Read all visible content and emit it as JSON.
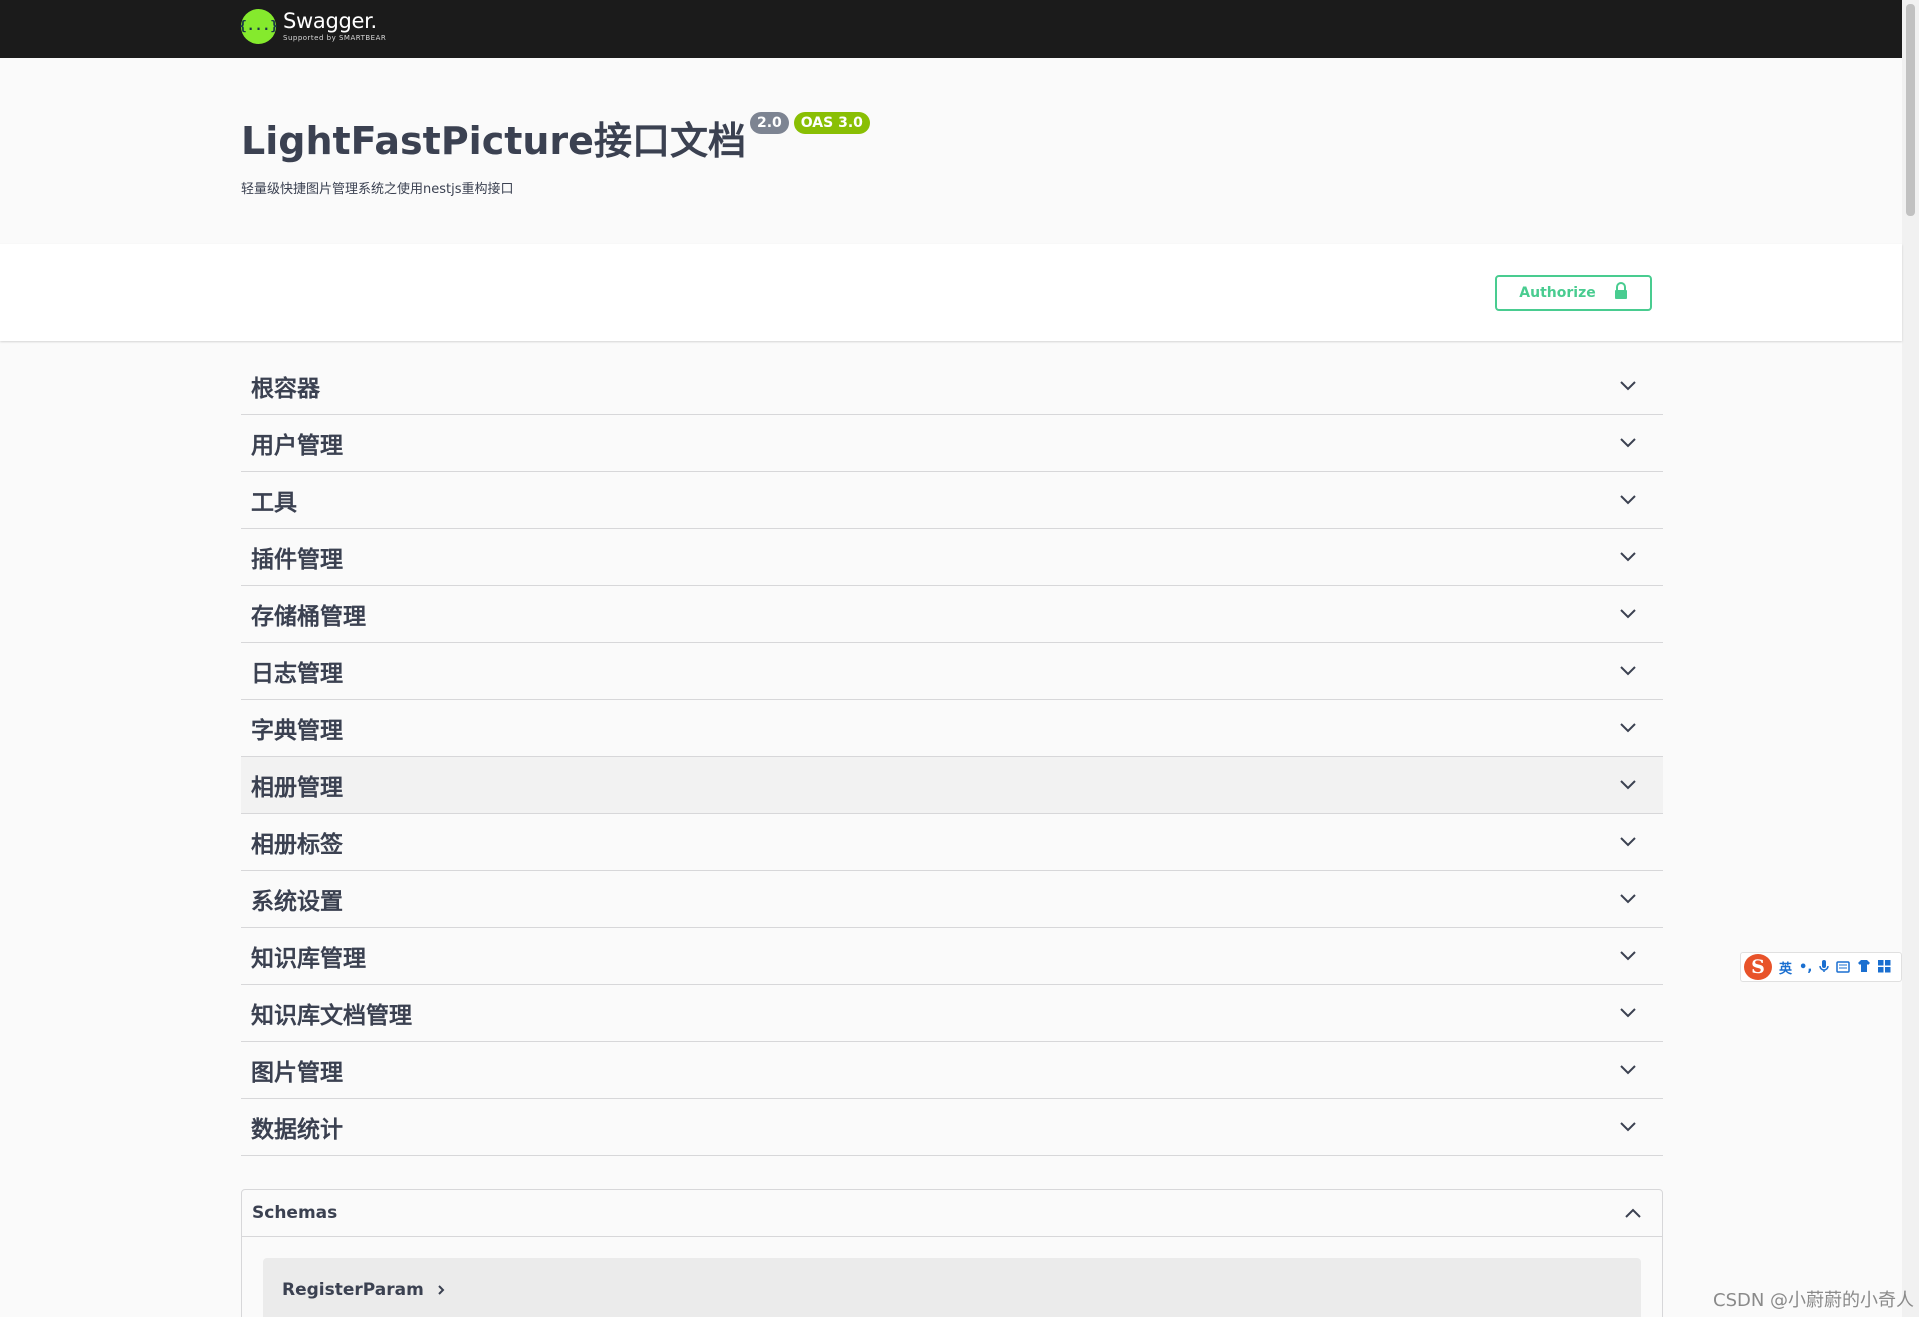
{
  "topbar": {
    "logo_icon": "{...}",
    "logo_name": "Swagger.",
    "logo_sub": "Supported by SMARTBEAR"
  },
  "info": {
    "title": "LightFastPicture接口文档",
    "version_badge": "2.0",
    "oas_badge": "OAS 3.0",
    "description": "轻量级快捷图片管理系统之使用nestjs重构接口"
  },
  "authorize": {
    "label": "Authorize",
    "icon": "lock-icon"
  },
  "tags": [
    {
      "label": "根容器"
    },
    {
      "label": "用户管理"
    },
    {
      "label": "工具"
    },
    {
      "label": "插件管理"
    },
    {
      "label": "存储桶管理"
    },
    {
      "label": "日志管理"
    },
    {
      "label": "字典管理"
    },
    {
      "label": "相册管理"
    },
    {
      "label": "相册标签"
    },
    {
      "label": "系统设置"
    },
    {
      "label": "知识库管理"
    },
    {
      "label": "知识库文档管理"
    },
    {
      "label": "图片管理"
    },
    {
      "label": "数据统计"
    }
  ],
  "schemas": {
    "title": "Schemas",
    "models": [
      {
        "name": "RegisterParam"
      }
    ]
  },
  "ime_toolbar": {
    "logo": "S",
    "lang": "英",
    "punct": "•,",
    "icons": [
      "mic-icon",
      "keyboard-icon",
      "skin-icon",
      "apps-icon"
    ]
  },
  "watermark": "CSDN @小蔚蔚的小奇人",
  "colors": {
    "topbar_bg": "#1b1b1b",
    "logo_green": "#85ea2d",
    "authorize_green": "#49cc90",
    "badge_gray": "#7d8492",
    "badge_green": "#89bf04",
    "text": "#3b4151"
  }
}
